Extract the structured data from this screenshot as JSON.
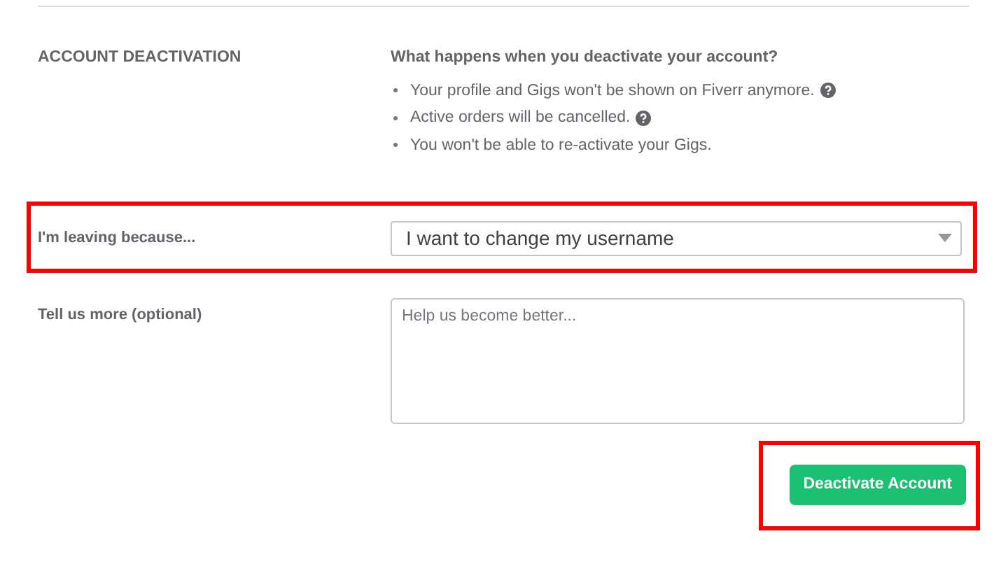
{
  "section": {
    "title": "ACCOUNT DEACTIVATION",
    "heading": "What happens when you deactivate your account?",
    "bullets": [
      {
        "text": "Your profile and Gigs won't be shown on Fiverr anymore.",
        "help": true
      },
      {
        "text": "Active orders will be cancelled.",
        "help": true
      },
      {
        "text": "You won't be able to re-activate your Gigs.",
        "help": false
      }
    ]
  },
  "reason": {
    "label": "I'm leaving because...",
    "value": "I want to change my username",
    "highlighted": true
  },
  "more": {
    "label": "Tell us more (optional)",
    "placeholder": "Help us become better..."
  },
  "button": {
    "label": "Deactivate Account",
    "highlighted": true
  }
}
